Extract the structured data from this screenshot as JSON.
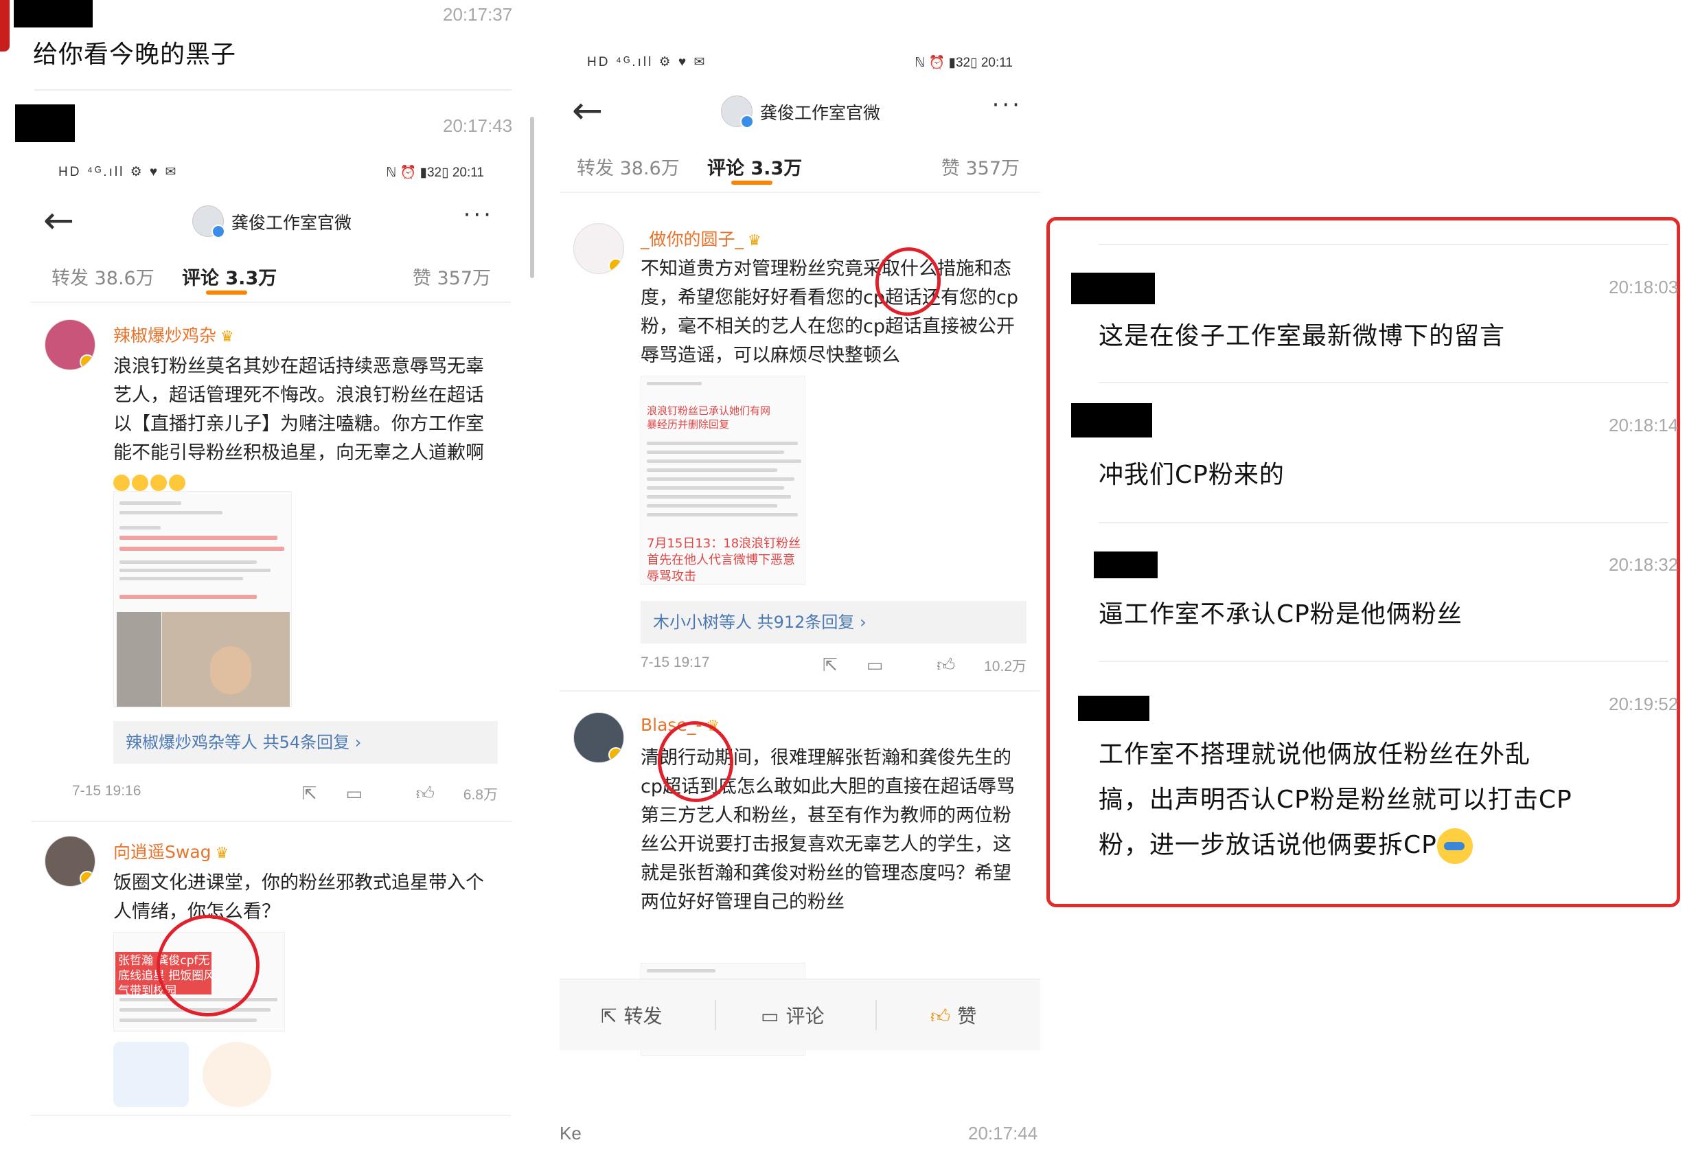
{
  "left_chat": {
    "msg1": {
      "time": "20:17:37",
      "text": "给你看今晚的黑子"
    },
    "msg2": {
      "time": "20:17:43"
    }
  },
  "phone1": {
    "status_right": "20:11",
    "title": "龚俊工作室官微",
    "tabs": {
      "reposts": "转发 38.6万",
      "comments": "评论 3.3万",
      "likes": "赞 357万"
    },
    "comment1": {
      "name": "辣椒爆炒鸡杂",
      "text": "浪浪钉粉丝莫名其妙在超话持续恶意辱骂无辜艺人，超话管理死不悔改。浪浪钉粉丝在超话以【直播打亲儿子】为赌注嗑糖。你方工作室能不能引导粉丝积极追星，向无辜之人道歉啊",
      "replies": "辣椒爆炒鸡杂等人  共54条回复 ›",
      "date": "7-15 19:16",
      "likes": "6.8万"
    },
    "comment2": {
      "name": "向逍遥Swag",
      "text": "饭圈文化进课堂，你的粉丝邪教式追星带入个人情绪，你怎么看？",
      "img_text": "张哲瀚 龚俊cpf无底线追星 把饭圈风气带到校园"
    }
  },
  "phone2": {
    "status_right": "20:11",
    "title": "龚俊工作室官微",
    "tabs": {
      "reposts": "转发 38.6万",
      "comments": "评论 3.3万",
      "likes": "赞 357万"
    },
    "comment1": {
      "name": "_做你的圆子_",
      "text": "不知道贵方对管理粉丝究竟采取什么措施和态度，希望您能好好看看您的cp超话还有您的cp粉，毫不相关的艺人在您的cp超话直接被公开辱骂造谣，可以麻烦尽快整顿么",
      "img_red1": "浪浪钉粉丝已承认她们有网暴经历并删除回复",
      "img_red2": "7月15日13：18浪浪钉粉丝首先在他人代言微博下恶意辱骂攻击",
      "replies": "木小小树等人  共912条回复 ›",
      "date": "7-15 19:17",
      "likes": "10.2万"
    },
    "comment2": {
      "name": "Blase_-",
      "text": "清朗行动期间，很难理解张哲瀚和龚俊先生的cp超话到底怎么敢如此大胆的直接在超话辱骂第三方艺人和粉丝，甚至有作为教师的两位粉丝公开说要打击报复喜欢无辜艺人的学生，这就是张哲瀚和龚俊对粉丝的管理态度吗？希望两位好好管理自己的粉丝"
    },
    "bottom": {
      "repost": "转发",
      "comment": "评论",
      "like": "赞"
    },
    "below_time": "20:17:44",
    "below_partial": "Ke"
  },
  "right_chat": [
    {
      "time": "20:18:03",
      "text": "这是在俊子工作室最新微博下的留言"
    },
    {
      "time": "20:18:14",
      "text": "冲我们CP粉来的"
    },
    {
      "time": "20:18:32",
      "text": "逼工作室不承认CP粉是他俩粉丝"
    },
    {
      "time": "20:19:52",
      "line1": "工作室不搭理就说他俩放任粉丝在外乱",
      "line2": "搞，出声明否认CP粉是粉丝就可以打击CP",
      "line3": "粉，进一步放话说他俩要拆CP"
    }
  ],
  "colors": {
    "accent": "#ff8200",
    "username": "#e8742b",
    "highlight_box": "#e22b2b"
  }
}
